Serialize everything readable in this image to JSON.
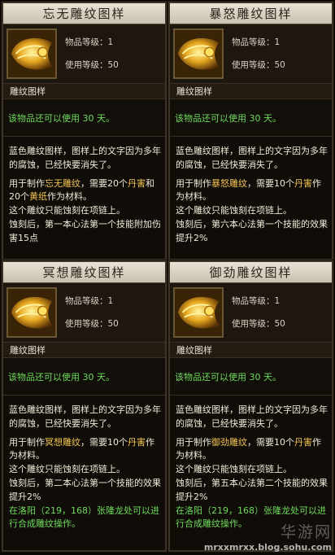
{
  "items": [
    {
      "title": "忘无雕纹图样",
      "level_label": "物品等级：1",
      "use_level_label": "使用等级：50",
      "category": "雕纹图样",
      "validity": "该物品还可以使用  30 天。",
      "desc1": "蓝色雕纹图样，图样上的文字因为多年的腐蚀，已经快要消失了。",
      "use_pre": "用于制作",
      "use_name": "忘无雕纹",
      "use_mid": "，需要20个",
      "use_mat1": "丹害",
      "use_and": "和20个",
      "use_mat2": "黄纸",
      "use_post": "作为材料。",
      "line3": "这个雕纹只能蚀刻在项链上。",
      "line4": "蚀刻后，第一本心法第一个技能附加伤害15点",
      "extra": ""
    },
    {
      "title": "暴怒雕纹图样",
      "level_label": "物品等级：1",
      "use_level_label": "使用等级：50",
      "category": "雕纹图样",
      "validity": "该物品还可以使用  30 天。",
      "desc1": "蓝色雕纹图样，图样上的文字因为多年的腐蚀，已经快要消失了。",
      "use_pre": "用于制作",
      "use_name": "暴怒雕纹",
      "use_mid": "，需要10个",
      "use_mat1": "丹害",
      "use_and": "",
      "use_mat2": "",
      "use_post": "作为材料。",
      "line3": "这个雕纹只能蚀刻在项链上。",
      "line4": "蚀刻后，第六本心法第一个技能的效果提升2%",
      "extra": ""
    },
    {
      "title": "冥想雕纹图样",
      "level_label": "物品等级：1",
      "use_level_label": "使用等级：50",
      "category": "雕纹图样",
      "validity": "该物品还可以使用  30 天。",
      "desc1": "蓝色雕纹图样，图样上的文字因为多年的腐蚀，已经快要消失了。",
      "use_pre": "用于制作",
      "use_name": "冥想雕纹",
      "use_mid": "，需要10个",
      "use_mat1": "丹害",
      "use_and": "",
      "use_mat2": "",
      "use_post": "作为材料。",
      "line3": "这个雕纹只能蚀刻在项链上。",
      "line4": "蚀刻后，第二本心法第一个技能的效果提升2%",
      "extra": "在洛阳（219，168）张隆龙处可以进行合成雕纹操作。"
    },
    {
      "title": "御劲雕纹图样",
      "level_label": "物品等级：1",
      "use_level_label": "使用等级：50",
      "category": "雕纹图样",
      "validity": "该物品还可以使用  30 天。",
      "desc1": "蓝色雕纹图样，图样上的文字因为多年的腐蚀，已经快要消失了。",
      "use_pre": "用于制作",
      "use_name": "御劲雕纹",
      "use_mid": "，需要10个",
      "use_mat1": "丹害",
      "use_and": "",
      "use_mat2": "",
      "use_post": "作为材料。",
      "line3": "这个雕纹只能蚀刻在项链上。",
      "line4": "蚀刻后，第五本心法第二个技能的效果提升2%",
      "extra": "在洛阳（219，168）张隆龙处可以进行合成雕纹操作。"
    }
  ],
  "watermark": {
    "big": "华游网",
    "small": "mrxxmrxx.blog.sohu.com"
  },
  "colors": {
    "highlight": "#f0c454",
    "validity_green": "#6edb5c",
    "title_bar": "#ddd6c6",
    "panel_bg": "#17120c"
  },
  "icon": "golden-scroll-icon"
}
